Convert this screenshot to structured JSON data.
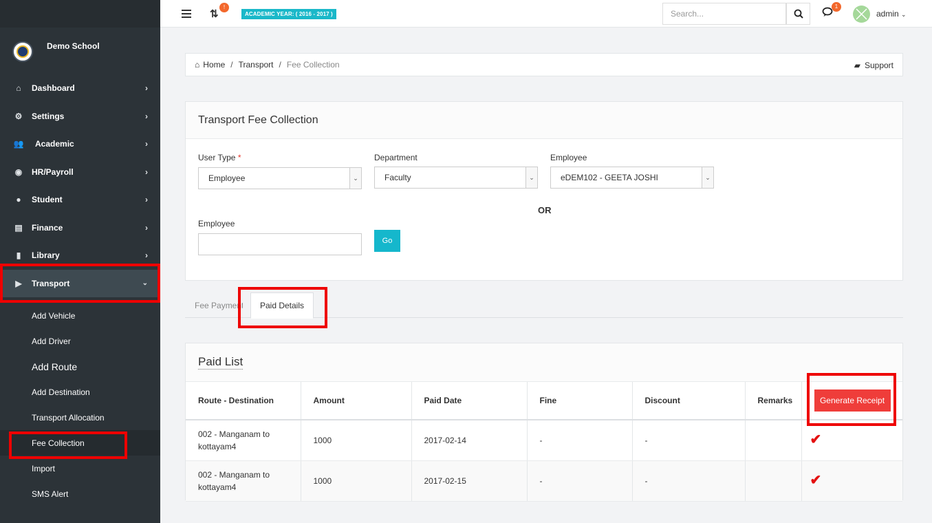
{
  "sidebar": {
    "school_name": "Demo School",
    "menu": [
      {
        "label": "Dashboard",
        "icon": "home-icon"
      },
      {
        "label": "Settings",
        "icon": "gears-icon"
      },
      {
        "label": "Academic",
        "icon": "users-icon"
      },
      {
        "label": "HR/Payroll",
        "icon": "eye-icon"
      },
      {
        "label": "Student",
        "icon": "user-icon"
      },
      {
        "label": "Finance",
        "icon": "money-icon"
      },
      {
        "label": "Library",
        "icon": "book-icon"
      },
      {
        "label": "Transport",
        "icon": "truck-icon"
      }
    ],
    "transport_submenu": [
      "Add Vehicle",
      "Add Driver",
      "Add Route",
      "Add Destination",
      "Transport Allocation",
      "Fee Collection",
      "Import",
      "SMS Alert"
    ]
  },
  "header": {
    "notification_count": "!",
    "academic_year": "ACADEMIC YEAR: ( 2016 - 2017 )",
    "search_placeholder": "Search...",
    "chat_count": "1",
    "user_name": "admin"
  },
  "breadcrumb": {
    "home": "Home",
    "section": "Transport",
    "current": "Fee Collection",
    "support": "Support"
  },
  "form": {
    "title": "Transport Fee Collection",
    "user_type_label": "User Type",
    "required_mark": "*",
    "user_type_value": "Employee",
    "department_label": "Department",
    "department_value": "Faculty",
    "employee_label": "Employee",
    "employee_value": "eDEM102 - GEETA JOSHI",
    "or_label": "OR",
    "employee_search_label": "Employee",
    "go_label": "Go"
  },
  "tabs": {
    "fee_payment": "Fee Payment",
    "paid_details": "Paid Details"
  },
  "paid_list": {
    "title": "Paid List",
    "columns": [
      "Route - Destination",
      "Amount",
      "Paid Date",
      "Fine",
      "Discount",
      "Remarks"
    ],
    "generate_label": "Generate Receipt",
    "rows": [
      {
        "route": "002 - Manganam to kottayam4",
        "amount": "1000",
        "date": "2017-02-14",
        "fine": "-",
        "discount": "-",
        "remarks": ""
      },
      {
        "route": "002 - Manganam to kottayam4",
        "amount": "1000",
        "date": "2017-02-15",
        "fine": "-",
        "discount": "-",
        "remarks": ""
      }
    ]
  },
  "colors": {
    "sidebar_bg": "#2c3338",
    "accent_cyan": "#15b7cc",
    "generate_red": "#ef3d3a",
    "highlight_red": "#ee0000"
  }
}
